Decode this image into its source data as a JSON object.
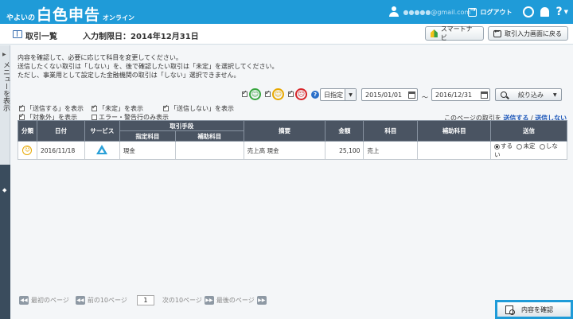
{
  "header": {
    "logo_prefix": "やよいの",
    "logo_main": "白色申告",
    "logo_suffix": "オンライン",
    "email": "●●●●●@gmail.com",
    "logout_label": "ログアウト",
    "help_label": "?"
  },
  "titlebar": {
    "title": "取引一覧",
    "deadline": "入力制限日：2014年12月31日",
    "smart_navi_label": "スマートナビ",
    "back_label": "取引入力画面に戻る"
  },
  "sidemenu": {
    "label": "メニューを表示"
  },
  "message": {
    "line1": "内容を確認して、必要に応じて科目を変更してください。",
    "line2": "送信したくない取引は「しない」を、後で確認したい取引は「未定」を選択してください。",
    "line3": "ただし、事業用として設定した金融機関の取引は「しない」選択できません。"
  },
  "filters": {
    "date_mode": "日指定",
    "date_from": "2015/01/01",
    "tilde": "～",
    "date_to": "2016/12/31",
    "narrow_label": "絞り込み"
  },
  "options": {
    "show_send": "「送信する」を表示",
    "show_undecided": "「未定」を表示",
    "show_not_send": "「送信しない」を表示",
    "show_excluded": "「対象外」を表示",
    "show_errors_only": "エラー・警告行のみ表示",
    "page_rows_prefix": "このページの取引を",
    "page_send_all": "送信する",
    "sep": "/",
    "page_send_none": "送信しない"
  },
  "table": {
    "headers": {
      "category": "分類",
      "date": "日付",
      "service": "サービス",
      "method": "取引手段",
      "specified_account": "指定科目",
      "sub_account_1": "補助科目",
      "description": "摘要",
      "amount": "金額",
      "account": "科目",
      "sub_account_2": "補助科目",
      "send": "送信"
    },
    "rows": [
      {
        "date": "2016/11/18",
        "method_account": "現金",
        "method_sub": "",
        "description": "売上高 現金",
        "amount": "25,100",
        "account": "売上",
        "sub_account": "",
        "send_yes": "する",
        "send_undecided": "未定",
        "send_no": "しない"
      }
    ]
  },
  "pager": {
    "first": "最初のページ",
    "prev10": "前の10ページ",
    "current": "1",
    "next10": "次の10ページ",
    "last": "最後のページ"
  },
  "footer": {
    "confirm_label": "内容を確認"
  },
  "colors": {
    "brand": "#1f9bd8",
    "header_dark": "#4a5462"
  }
}
